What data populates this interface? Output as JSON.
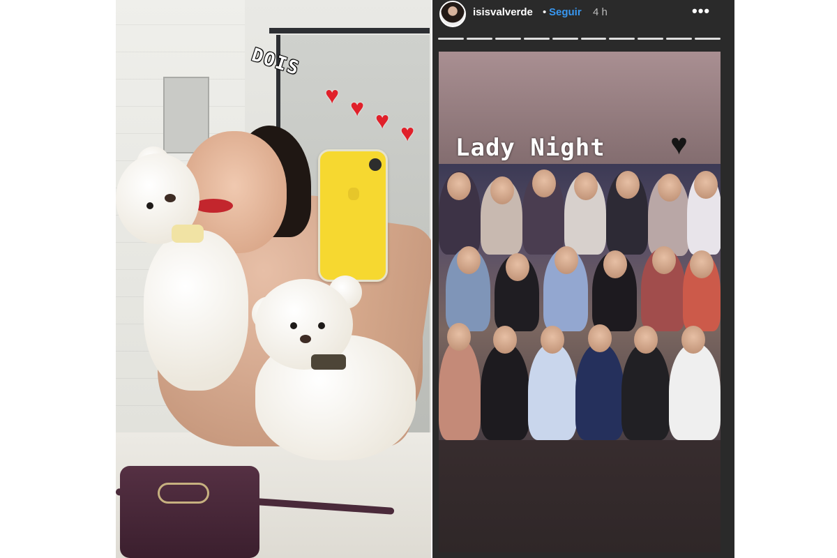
{
  "left_photo": {
    "sticker_text": "DOIS",
    "heart_count": 4,
    "heart_color": "#e0202a"
  },
  "story": {
    "username": "isisvalverde",
    "separator": "•",
    "follow_label": "Seguir",
    "follow_color": "#3897f0",
    "time_ago": "4 h",
    "more_label": "•••",
    "progress_segments": 10,
    "active_segment": 10,
    "sticker_text": "Lady Night",
    "sticker_emoji": "♥",
    "emoji_name": "black-heart-icon"
  }
}
